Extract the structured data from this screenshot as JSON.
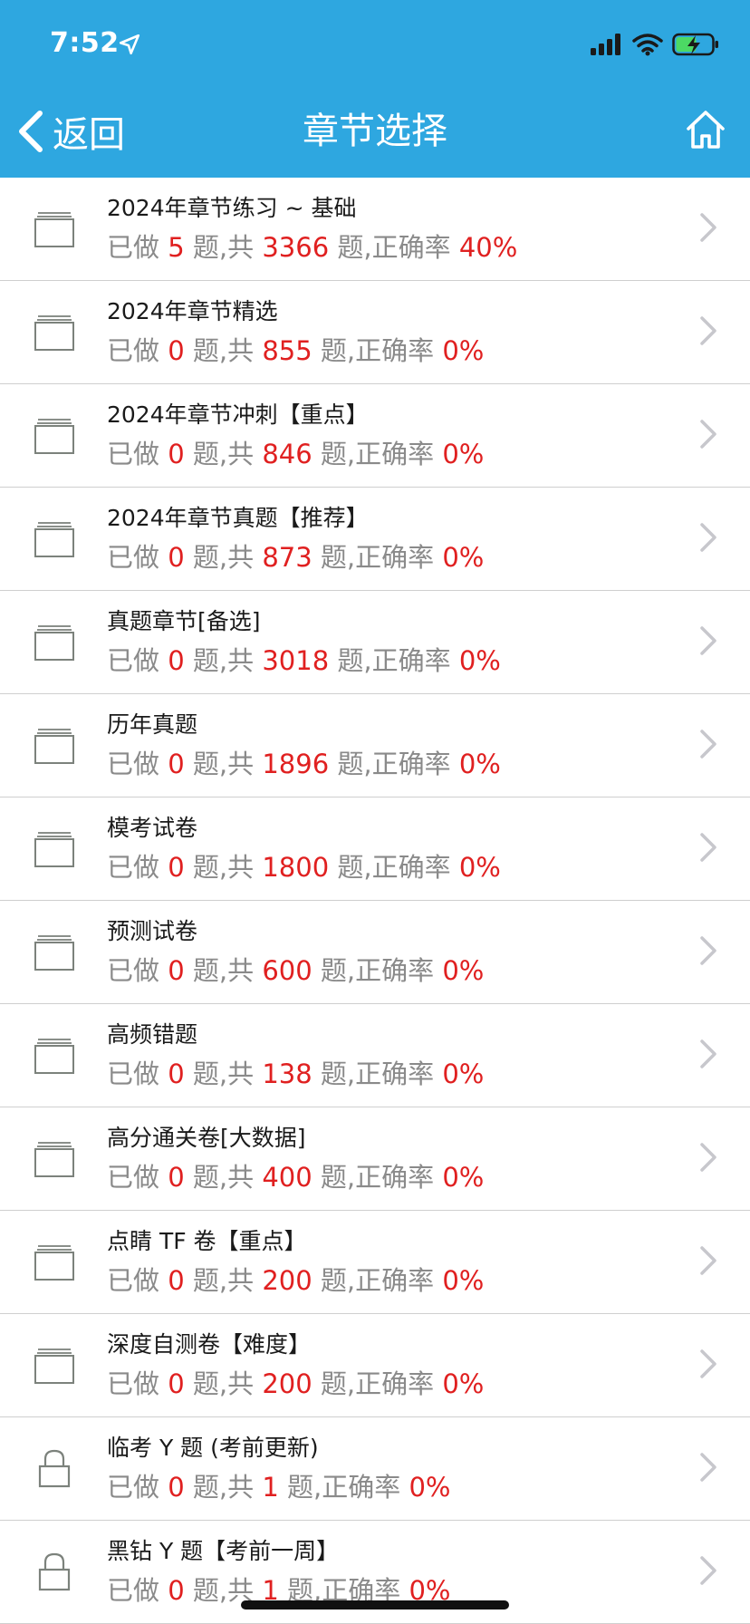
{
  "status_bar": {
    "time": "7:52",
    "icons": [
      "location-arrow-icon",
      "signal-icon",
      "wifi-icon",
      "battery-charging-icon"
    ]
  },
  "nav": {
    "back_label": "返回",
    "title": "章节选择",
    "home_icon": "home-icon"
  },
  "colors": {
    "header_bg": "#2ea7e0",
    "highlight_number": "#e02020",
    "secondary_text": "#8a8a8a"
  },
  "stats_template": {
    "done_prefix": "已做",
    "questions_unit": "题",
    "total_prefix": ",共",
    "accuracy_prefix": "题,正确率"
  },
  "chapters": [
    {
      "title": "2024年章节练习 ~ 基础",
      "done": "5",
      "total": "3366",
      "accuracy": "40%",
      "icon": "folder-stack-icon"
    },
    {
      "title": "2024年章节精选",
      "done": "0",
      "total": "855",
      "accuracy": "0%",
      "icon": "folder-stack-icon"
    },
    {
      "title": "2024年章节冲刺【重点】",
      "done": "0",
      "total": "846",
      "accuracy": "0%",
      "icon": "folder-stack-icon"
    },
    {
      "title": "2024年章节真题【推荐】",
      "done": "0",
      "total": "873",
      "accuracy": "0%",
      "icon": "folder-stack-icon"
    },
    {
      "title": "真题章节[备选]",
      "done": "0",
      "total": "3018",
      "accuracy": "0%",
      "icon": "folder-stack-icon"
    },
    {
      "title": "历年真题",
      "done": "0",
      "total": "1896",
      "accuracy": "0%",
      "icon": "folder-stack-icon"
    },
    {
      "title": "模考试卷",
      "done": "0",
      "total": "1800",
      "accuracy": "0%",
      "icon": "folder-stack-icon"
    },
    {
      "title": "预测试卷",
      "done": "0",
      "total": "600",
      "accuracy": "0%",
      "icon": "folder-stack-icon"
    },
    {
      "title": "高频错题",
      "done": "0",
      "total": "138",
      "accuracy": "0%",
      "icon": "folder-stack-icon"
    },
    {
      "title": "高分通关卷[大数据]",
      "done": "0",
      "total": "400",
      "accuracy": "0%",
      "icon": "folder-stack-icon"
    },
    {
      "title": "点睛 TF 卷【重点】",
      "done": "0",
      "total": "200",
      "accuracy": "0%",
      "icon": "folder-stack-icon"
    },
    {
      "title": "深度自测卷【难度】",
      "done": "0",
      "total": "200",
      "accuracy": "0%",
      "icon": "folder-stack-icon"
    },
    {
      "title": "临考 Y 题 (考前更新)",
      "done": "0",
      "total": "1",
      "accuracy": "0%",
      "icon": "lock-icon"
    },
    {
      "title": "黑钻 Y 题【考前一周】",
      "done": "0",
      "total": "1",
      "accuracy": "0%",
      "icon": "lock-icon"
    }
  ]
}
